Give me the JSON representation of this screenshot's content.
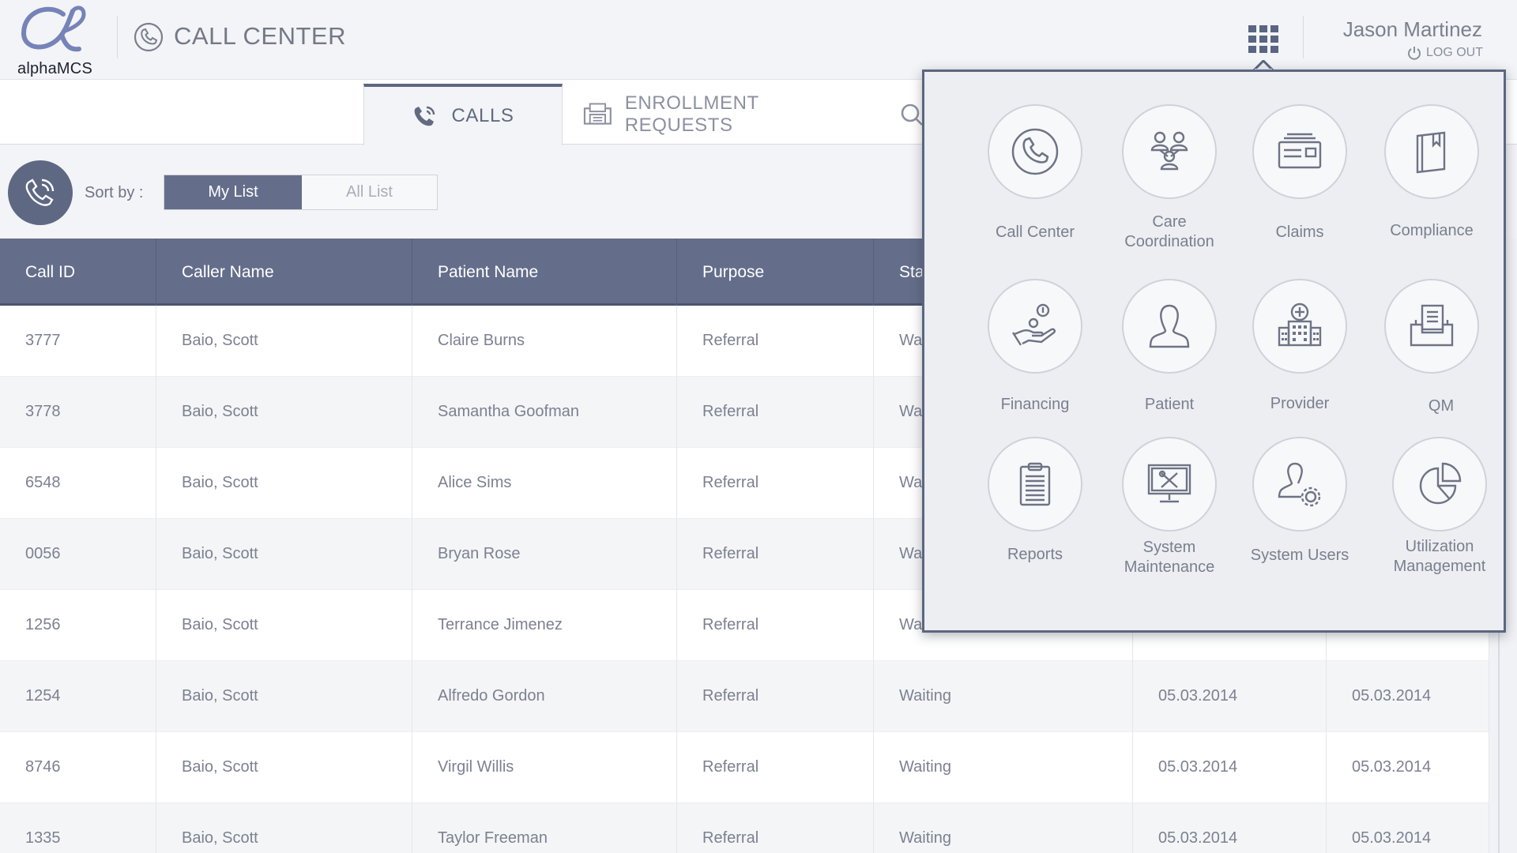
{
  "header": {
    "logo_text": "alphaMCS",
    "app_title": "CALL CENTER",
    "user_name": "Jason Martinez",
    "logout_label": "LOG OUT"
  },
  "tabs": [
    {
      "label": "CALLS",
      "icon": "phone-ringing-icon",
      "active": true
    },
    {
      "label": "ENROLLMENT REQUESTS",
      "icon": "fax-icon",
      "active": false
    },
    {
      "label": "",
      "icon": "search-icon",
      "active": false
    }
  ],
  "toolbar": {
    "sort_label": "Sort by :",
    "my_list": "My List",
    "all_list": "All List"
  },
  "table": {
    "columns": [
      "Call ID",
      "Caller Name",
      "Patient Name",
      "Purpose",
      "Sta",
      "",
      ""
    ],
    "rows": [
      [
        "3777",
        "Baio, Scott",
        "Claire Burns",
        "Referral",
        "Wai",
        "",
        ""
      ],
      [
        "3778",
        "Baio, Scott",
        "Samantha Goofman",
        "Referral",
        "Wai",
        "",
        ""
      ],
      [
        "6548",
        "Baio, Scott",
        "Alice Sims",
        "Referral",
        "Wai",
        "",
        ""
      ],
      [
        "0056",
        "Baio, Scott",
        "Bryan Rose",
        "Referral",
        "Wai",
        "",
        ""
      ],
      [
        "1256",
        "Baio, Scott",
        "Terrance Jimenez",
        "Referral",
        "Wai",
        "",
        ""
      ],
      [
        "1254",
        "Baio, Scott",
        "Alfredo Gordon",
        "Referral",
        "Waiting",
        "05.03.2014",
        "05.03.2014"
      ],
      [
        "8746",
        "Baio, Scott",
        "Virgil Willis",
        "Referral",
        "Waiting",
        "05.03.2014",
        "05.03.2014"
      ],
      [
        "1335",
        "Baio, Scott",
        "Taylor Freeman",
        "Referral",
        "Waiting",
        "05.03.2014",
        "05.03.2014"
      ]
    ]
  },
  "apps": [
    {
      "label": "Call Center",
      "icon": "phone-icon"
    },
    {
      "label": "Care Coordination",
      "icon": "care-team-icon"
    },
    {
      "label": "Claims",
      "icon": "claims-icon"
    },
    {
      "label": "Compliance",
      "icon": "compliance-book-icon"
    },
    {
      "label": "Financing",
      "icon": "financing-hand-icon"
    },
    {
      "label": "Patient",
      "icon": "patient-icon"
    },
    {
      "label": "Provider",
      "icon": "provider-hospital-icon"
    },
    {
      "label": "QM",
      "icon": "qm-inbox-icon"
    },
    {
      "label": "Reports",
      "icon": "reports-clipboard-icon"
    },
    {
      "label": "System Maintenance",
      "icon": "system-maintenance-icon"
    },
    {
      "label": "System Users",
      "icon": "system-users-icon"
    },
    {
      "label": "Utilization Management",
      "icon": "utilization-pie-icon"
    }
  ],
  "colors": {
    "accent": "#646e8a",
    "header_bg": "#f3f4f7",
    "popup_border": "#5c6680"
  }
}
